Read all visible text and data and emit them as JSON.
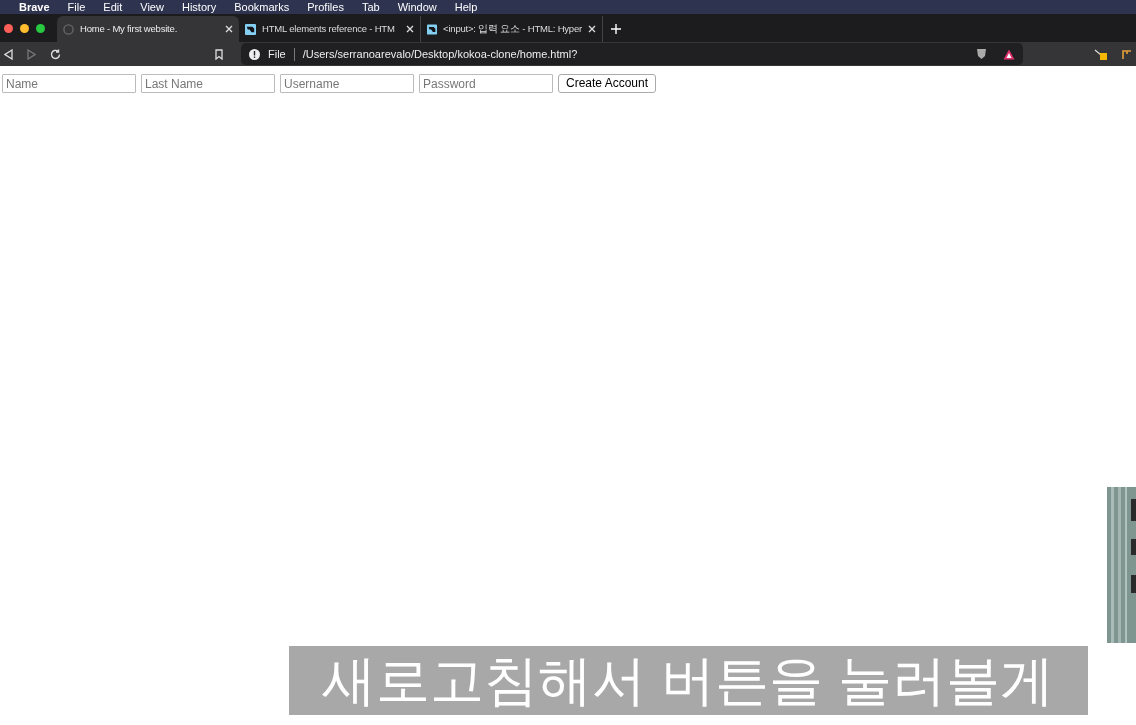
{
  "menu_bar": {
    "items": [
      "Brave",
      "File",
      "Edit",
      "View",
      "History",
      "Bookmarks",
      "Profiles",
      "Tab",
      "Window",
      "Help"
    ]
  },
  "tabs": [
    {
      "label": "Home - My first website.",
      "selected": true,
      "kind": "globe"
    },
    {
      "label": "HTML elements reference - HTM",
      "selected": false,
      "kind": "mdn"
    },
    {
      "label": "<input>: 입력 요소 - HTML: Hyper",
      "selected": false,
      "kind": "mdn"
    }
  ],
  "address_bar": {
    "scheme": "File",
    "url": "/Users/serranoarevalo/Desktop/kokoa-clone/home.html?"
  },
  "form": {
    "fields": [
      {
        "placeholder": "Name"
      },
      {
        "placeholder": "Last Name"
      },
      {
        "placeholder": "Username"
      },
      {
        "placeholder": "Password"
      }
    ],
    "button": "Create Account"
  },
  "caption": "새로고침해서 버튼을 눌러볼게"
}
